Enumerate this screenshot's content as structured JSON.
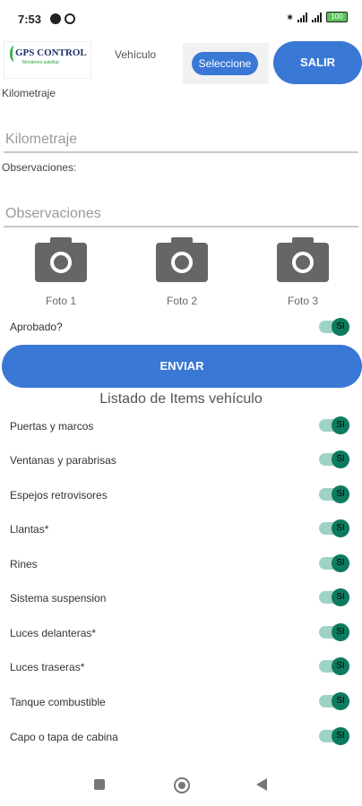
{
  "status_bar": {
    "time": "7:53",
    "battery": "100"
  },
  "header": {
    "logo_text": "GPS CONTROL",
    "logo_sub": "Monitoreo satelital",
    "vehicle_label": "Vehículo",
    "select_label": "Seleccione",
    "salir_label": "SALIR"
  },
  "form": {
    "km_label": "Kilometraje",
    "km_placeholder": "Kilometraje",
    "obs_label": "Observaciones:",
    "obs_placeholder": "Observaciones",
    "photos": [
      "Foto 1",
      "Foto 2",
      "Foto 3"
    ],
    "approved_label": "Aprobado?",
    "approved_toggle": "SI",
    "send_label": "ENVIAR"
  },
  "items": {
    "title": "Listado de Items vehículo",
    "toggle_label": "SI",
    "rows": [
      "Puertas y marcos",
      "Ventanas y parabrisas",
      "Espejos retrovisores",
      "Llantas*",
      "Rines",
      "Sistema suspension",
      "Luces delanteras*",
      "Luces traseras*",
      "Tanque combustible",
      "Capo o tapa de cabina"
    ]
  },
  "colors": {
    "primary": "#3a78d6",
    "toggle_on": "#0e7a5f",
    "toggle_track": "#9dd2c5"
  }
}
